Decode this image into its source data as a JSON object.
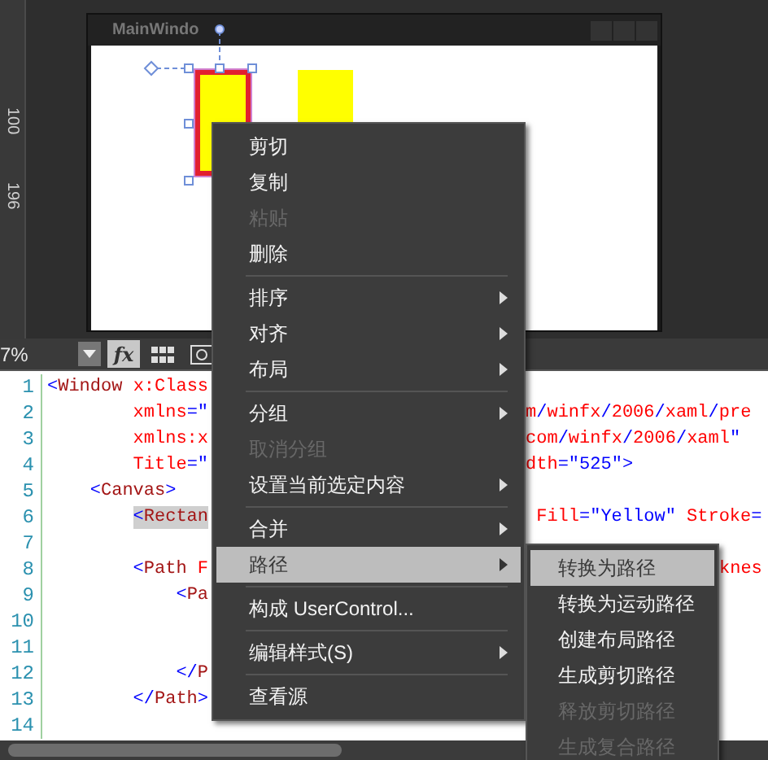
{
  "designer": {
    "ruler_labels": [
      "100",
      "196"
    ],
    "window_title": "MainWindo"
  },
  "toolbar": {
    "zoom": "7%",
    "buttons": [
      {
        "kind": "fx",
        "label": "fx",
        "selected": true
      },
      {
        "kind": "grid",
        "selected": false
      },
      {
        "kind": "snap",
        "selected": false
      }
    ]
  },
  "code_lines": [
    {
      "number": "1",
      "text": "<Window x:Class"
    },
    {
      "number": "2",
      "text": "        xmlns=\"",
      "after_menu": "m/winfx/2006/xaml/pre"
    },
    {
      "number": "3",
      "text": "        xmlns:x",
      "after_menu": "com/winfx/2006/xaml\""
    },
    {
      "number": "4",
      "text": "        Title=\"",
      "after_menu": "dth=\"525\">"
    },
    {
      "number": "5",
      "text": "    <Canvas>"
    },
    {
      "number": "6",
      "text": "        <Rectan",
      "highlighted": true,
      "after_menu": " Fill=\"Yellow\" Stroke="
    },
    {
      "number": "7"
    },
    {
      "number": "8",
      "text": "        <Path F",
      "after_submenu": "knes"
    },
    {
      "number": "9",
      "text": "            <Pa"
    },
    {
      "number": "10"
    },
    {
      "number": "11"
    },
    {
      "number": "12",
      "text": "            </P"
    },
    {
      "number": "13",
      "text": "        </Path>"
    },
    {
      "number": "14"
    }
  ],
  "context_menu": {
    "items": [
      {
        "kind": "item",
        "label": "剪切",
        "disabled": false,
        "submenu": false,
        "selected": false
      },
      {
        "kind": "item",
        "label": "复制",
        "disabled": false,
        "submenu": false,
        "selected": false
      },
      {
        "kind": "item",
        "label": "粘贴",
        "disabled": true,
        "submenu": false,
        "selected": false
      },
      {
        "kind": "item",
        "label": "删除",
        "disabled": false,
        "submenu": false,
        "selected": false
      },
      {
        "kind": "separator"
      },
      {
        "kind": "item",
        "label": "排序",
        "disabled": false,
        "submenu": true,
        "selected": false
      },
      {
        "kind": "item",
        "label": "对齐",
        "disabled": false,
        "submenu": true,
        "selected": false
      },
      {
        "kind": "item",
        "label": "布局",
        "disabled": false,
        "submenu": true,
        "selected": false
      },
      {
        "kind": "separator"
      },
      {
        "kind": "item",
        "label": "分组",
        "disabled": false,
        "submenu": true,
        "selected": false
      },
      {
        "kind": "item",
        "label": "取消分组",
        "disabled": true,
        "submenu": false,
        "selected": false
      },
      {
        "kind": "item",
        "label": "设置当前选定内容",
        "disabled": false,
        "submenu": true,
        "selected": false
      },
      {
        "kind": "separator"
      },
      {
        "kind": "item",
        "label": "合并",
        "disabled": false,
        "submenu": true,
        "selected": false
      },
      {
        "kind": "item",
        "label": "路径",
        "disabled": false,
        "submenu": true,
        "selected": true
      },
      {
        "kind": "separator"
      },
      {
        "kind": "item",
        "label": "构成 UserControl...",
        "disabled": false,
        "submenu": false,
        "selected": false
      },
      {
        "kind": "separator"
      },
      {
        "kind": "item",
        "label": "编辑样式(S)",
        "disabled": false,
        "submenu": true,
        "selected": false
      },
      {
        "kind": "separator"
      },
      {
        "kind": "item",
        "label": "查看源",
        "disabled": false,
        "submenu": false,
        "selected": false
      }
    ]
  },
  "submenu": {
    "items": [
      {
        "label": "转换为路径",
        "disabled": false,
        "selected": true
      },
      {
        "label": "转换为运动路径",
        "disabled": false,
        "selected": false
      },
      {
        "label": "创建布局路径",
        "disabled": false,
        "selected": false
      },
      {
        "label": "生成剪切路径",
        "disabled": false,
        "selected": false
      },
      {
        "label": "释放剪切路径",
        "disabled": true,
        "selected": false
      },
      {
        "label": "生成复合路径",
        "disabled": true,
        "selected": false
      }
    ]
  }
}
